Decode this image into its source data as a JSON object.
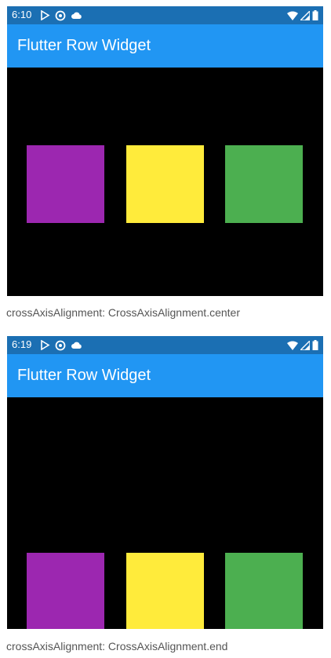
{
  "colors": {
    "status_bar": "#1b6fb3",
    "app_bar": "#2196f3",
    "content_bg": "#000000",
    "purple": "#9c27b0",
    "yellow": "#ffeb3b",
    "green": "#4caf50"
  },
  "screenshots": [
    {
      "status_time": "6:10",
      "status_icons_left": [
        "play-store-icon",
        "sync-icon",
        "cloud-icon"
      ],
      "status_icons_right": [
        "wifi-icon",
        "signal-icon",
        "battery-icon"
      ],
      "app_bar_title": "Flutter Row Widget",
      "boxes": [
        "purple",
        "yellow",
        "green"
      ],
      "caption": "crossAxisAlignment: CrossAxisAlignment.center"
    },
    {
      "status_time": "6:19",
      "status_icons_left": [
        "play-store-icon",
        "sync-icon",
        "cloud-icon"
      ],
      "status_icons_right": [
        "wifi-icon",
        "signal-icon",
        "battery-icon"
      ],
      "app_bar_title": "Flutter Row Widget",
      "boxes": [
        "purple",
        "yellow",
        "green"
      ],
      "caption": "crossAxisAlignment: CrossAxisAlignment.end"
    }
  ]
}
